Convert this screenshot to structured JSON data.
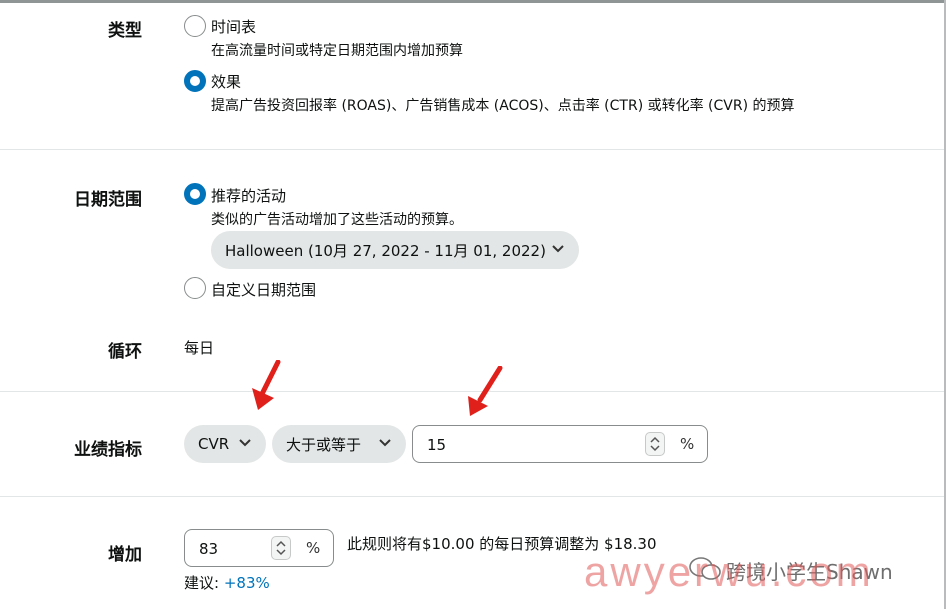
{
  "type_section": {
    "label": "类型",
    "options": [
      {
        "label": "时间表",
        "description": "在高流量时间或特定日期范围内增加预算",
        "selected": false
      },
      {
        "label": "效果",
        "description": "提高广告投资回报率 (ROAS)、广告销售成本 (ACOS)、点击率 (CTR) 或转化率 (CVR) 的预算",
        "selected": true
      }
    ]
  },
  "date_section": {
    "label": "日期范围",
    "recommended": {
      "label": "推荐的活动",
      "description": "类似的广告活动增加了这些活动的预算。",
      "selected": true
    },
    "event_select": "Halloween (10月 27, 2022 - 11月 01, 2022)",
    "custom": {
      "label": "自定义日期范围",
      "selected": false
    }
  },
  "cycle_section": {
    "label": "循环",
    "value": "每日"
  },
  "metric_section": {
    "label": "业绩指标",
    "metric_select": "CVR",
    "operator_select": "大于或等于",
    "threshold_value": "15",
    "unit": "%"
  },
  "increase_section": {
    "label": "增加",
    "value": "83",
    "unit": "%",
    "note": "此规则将有$10.00 的每日预算调整为 $18.30",
    "suggestion_prefix": "建议:",
    "suggestion_value": "+83%"
  },
  "watermark": {
    "account": "跨境小学生Shawn",
    "site": "awyerwu.com"
  },
  "colors": {
    "accent": "#0073bb",
    "arrow": "#e0201b",
    "link": "#007185",
    "pill": "#e3e6e6"
  }
}
